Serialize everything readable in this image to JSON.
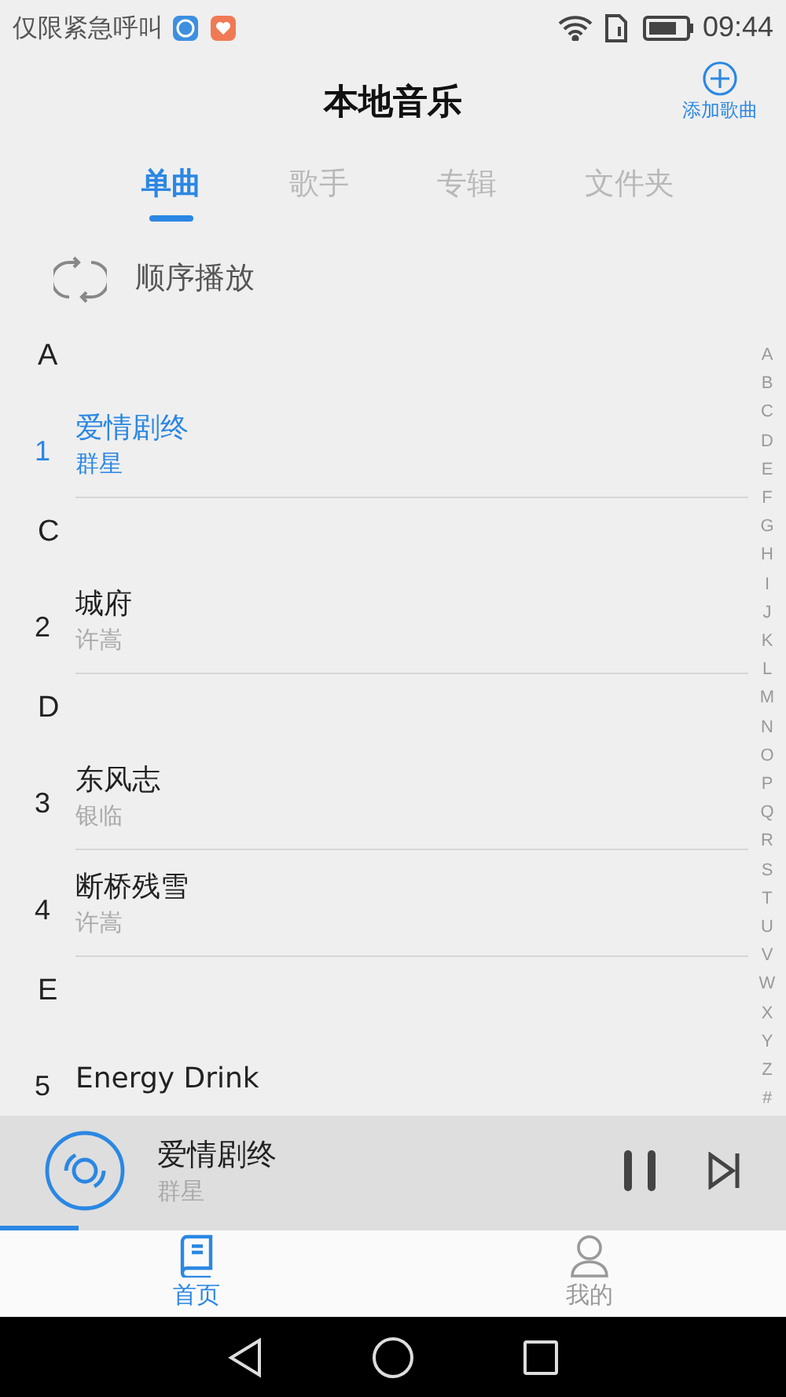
{
  "status_bar": {
    "carrier": "仅限紧急呼叫",
    "time": "09:44"
  },
  "header": {
    "title": "本地音乐",
    "add_button": "添加歌曲"
  },
  "tabs": [
    {
      "label": "单曲",
      "selected": true
    },
    {
      "label": "歌手",
      "selected": false
    },
    {
      "label": "专辑",
      "selected": false
    },
    {
      "label": "文件夹",
      "selected": false
    }
  ],
  "play_mode": "顺序播放",
  "sections": [
    {
      "letter": "A",
      "songs": [
        {
          "number": "1",
          "title": "爱情剧终",
          "artist": "群星",
          "selected": true
        }
      ]
    },
    {
      "letter": "C",
      "songs": [
        {
          "number": "2",
          "title": "城府",
          "artist": "许嵩",
          "selected": false
        }
      ]
    },
    {
      "letter": "D",
      "songs": [
        {
          "number": "3",
          "title": "东风志",
          "artist": "银临",
          "selected": false
        },
        {
          "number": "4",
          "title": "断桥残雪",
          "artist": "许嵩",
          "selected": false
        }
      ]
    },
    {
      "letter": "E",
      "songs": [
        {
          "number": "5",
          "title": "Energy Drink",
          "selected": false
        }
      ]
    }
  ],
  "index_letters": [
    "A",
    "B",
    "C",
    "D",
    "E",
    "F",
    "G",
    "H",
    "I",
    "J",
    "K",
    "L",
    "M",
    "N",
    "O",
    "P",
    "Q",
    "R",
    "S",
    "T",
    "U",
    "V",
    "W",
    "X",
    "Y",
    "Z",
    "#"
  ],
  "now_playing": {
    "title": "爱情剧终",
    "artist": "群星",
    "playing": true,
    "level": 0.1
  },
  "bottom_nav": [
    {
      "label": "首页",
      "selected": true,
      "kind": "home"
    },
    {
      "label": "我的",
      "selected": false,
      "kind": "profile"
    }
  ]
}
